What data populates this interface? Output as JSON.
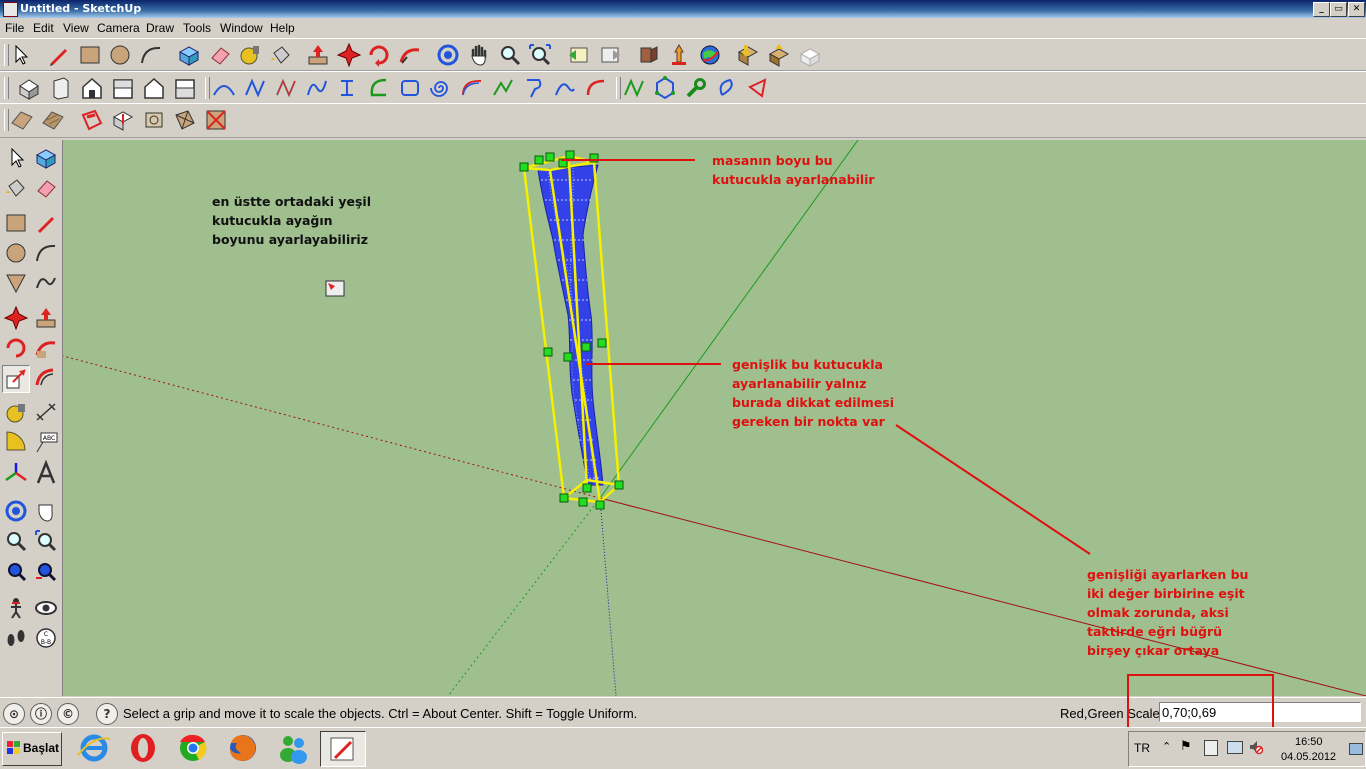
{
  "window": {
    "title": "Untitled - SketchUp",
    "controls": {
      "minimize": "_",
      "maximize": "▭",
      "close": "✕"
    }
  },
  "menu": [
    "File",
    "Edit",
    "View",
    "Camera",
    "Draw",
    "Tools",
    "Window",
    "Help"
  ],
  "annotations": {
    "left_note": [
      "en üstte ortadaki yeşil",
      "kutucukla ayağın",
      "boyunu ayarlayabiliriz"
    ],
    "top_note": [
      "masanın boyu bu",
      "kutucukla ayarlanabilir"
    ],
    "middle_note": [
      "genişlik bu kutucukla",
      "ayarlanabilir yalnız",
      "burada dikkat edilmesi",
      "gereken bir nokta var"
    ],
    "bottom_note": [
      "genişliği ayarlarken bu",
      "iki değer birbirine eşit",
      "olmak zorunda, aksi",
      "taktirde eğri büğrü",
      "birşey çıkar ortaya"
    ]
  },
  "status": {
    "message": "Select a grip and move it to scale the objects. Ctrl = About Center. Shift = Toggle Uniform.",
    "vcb_label": "Red,Green Scale",
    "vcb_value": "0,70;0,69",
    "help_icon": "?"
  },
  "taskbar": {
    "start_label": "Başlat",
    "language": "TR",
    "time": "16:50",
    "date": "04.05.2012"
  },
  "colors": {
    "viewport": "#9fbf8f",
    "annotation_red": "#e01010",
    "grip_green": "#22dd22",
    "bbox_yellow": "#f5f000",
    "model_blue": "#2233ee"
  }
}
